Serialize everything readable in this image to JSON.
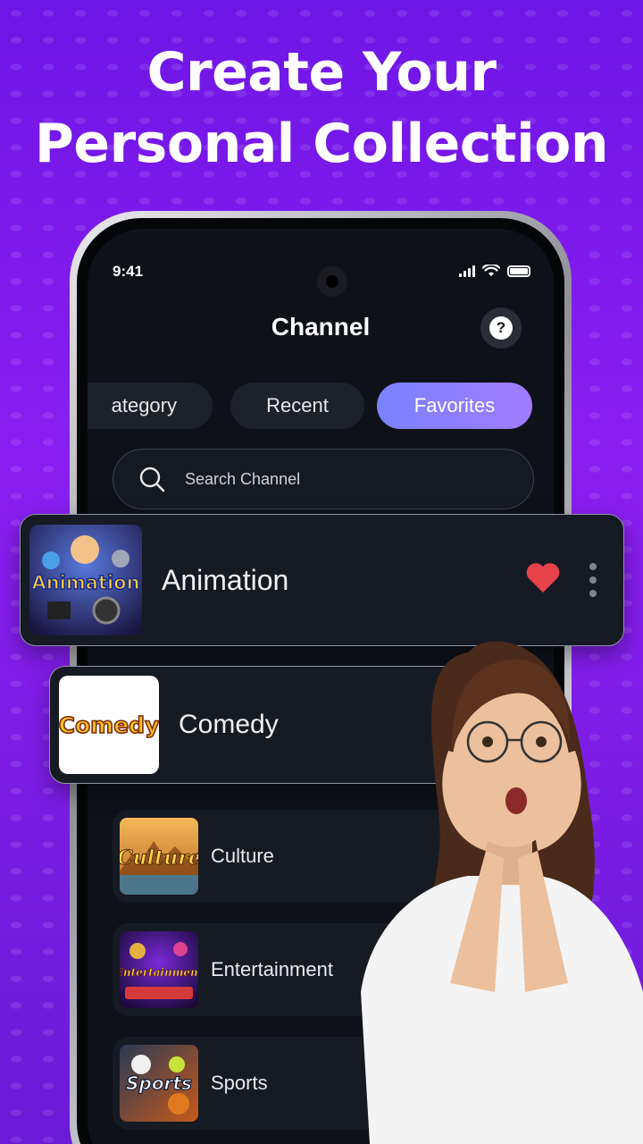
{
  "headline": {
    "line1": "Create Your",
    "line2": "Personal Collection"
  },
  "status": {
    "time": "9:41"
  },
  "app": {
    "title": "Channel",
    "help_label": "?"
  },
  "tabs": [
    {
      "label": "Category",
      "visible_text": "ategory",
      "active": false
    },
    {
      "label": "Recent",
      "active": false
    },
    {
      "label": "Favorites",
      "active": true
    }
  ],
  "search": {
    "placeholder": "Search Channel"
  },
  "featured": [
    {
      "label": "Animation",
      "thumb_text": "Animation",
      "favorited": true
    },
    {
      "label": "Comedy",
      "thumb_text": "Comedy"
    }
  ],
  "channels": [
    {
      "label": "Culture",
      "thumb_text": "Culture"
    },
    {
      "label": "Entertainment",
      "thumb_text": "Entertainment"
    },
    {
      "label": "Sports",
      "thumb_text": "Sports"
    }
  ],
  "colors": {
    "background": "#7a1aec",
    "screen": "#0e1118",
    "active_tab": "#8a80ff",
    "heart": "#e8434a"
  }
}
